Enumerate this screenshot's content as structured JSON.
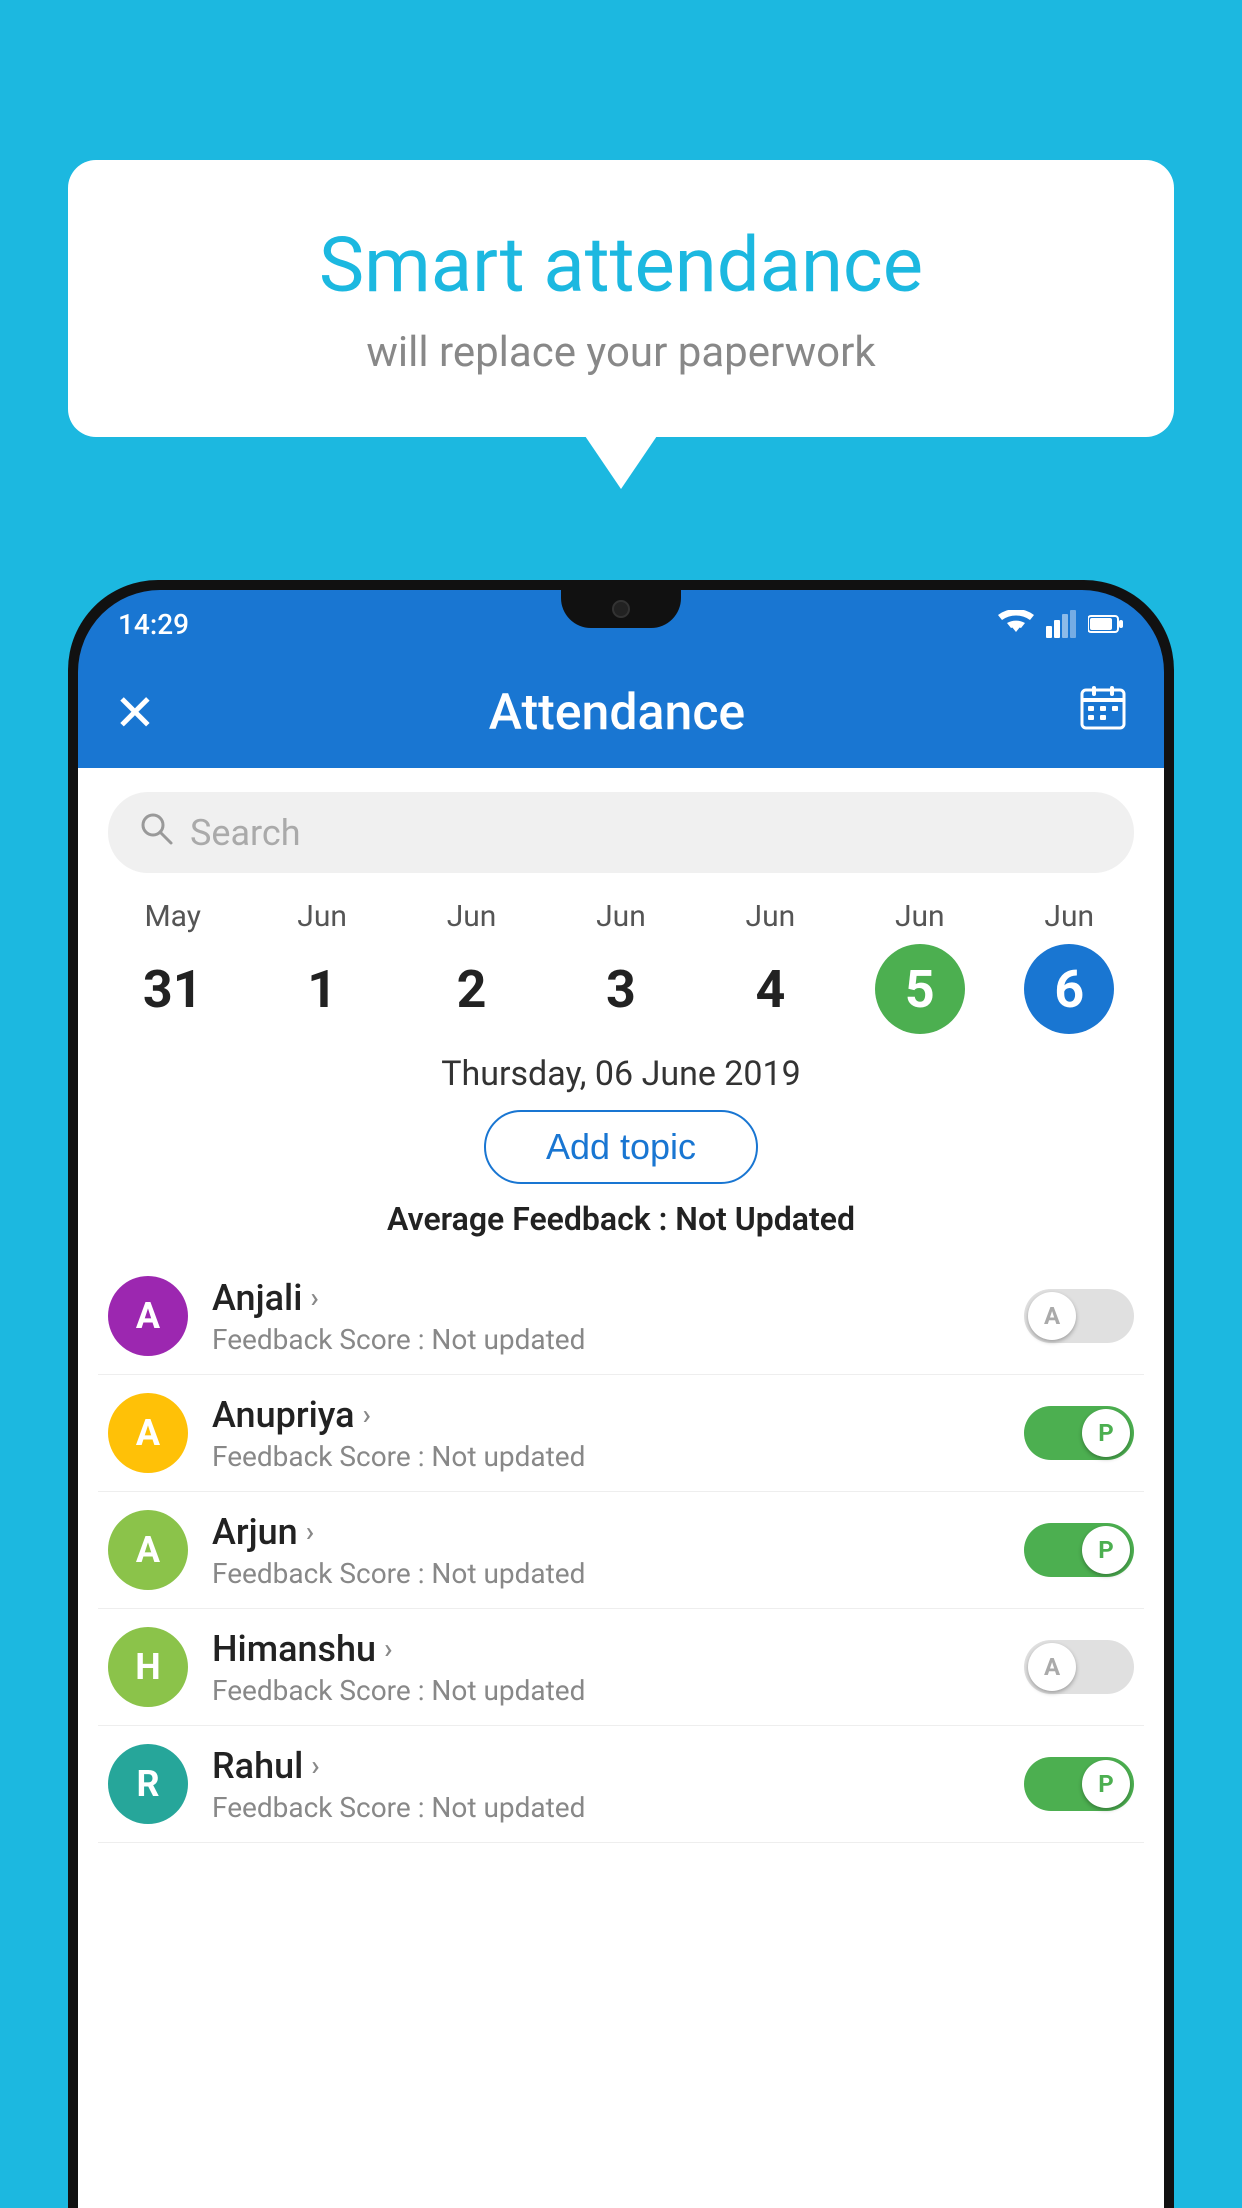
{
  "background_color": "#1CB8E0",
  "bubble": {
    "title": "Smart attendance",
    "subtitle": "will replace your paperwork"
  },
  "status_bar": {
    "time": "14:29",
    "wifi_icon": "wifi",
    "signal_icon": "signal",
    "battery_icon": "battery"
  },
  "app_bar": {
    "title": "Attendance",
    "close_icon": "×",
    "calendar_icon": "📅"
  },
  "search": {
    "placeholder": "Search"
  },
  "calendar": {
    "days": [
      {
        "month": "May",
        "date": "31",
        "style": "normal"
      },
      {
        "month": "Jun",
        "date": "1",
        "style": "normal"
      },
      {
        "month": "Jun",
        "date": "2",
        "style": "normal"
      },
      {
        "month": "Jun",
        "date": "3",
        "style": "normal"
      },
      {
        "month": "Jun",
        "date": "4",
        "style": "normal"
      },
      {
        "month": "Jun",
        "date": "5",
        "style": "green"
      },
      {
        "month": "Jun",
        "date": "6",
        "style": "blue"
      }
    ]
  },
  "selected_date": "Thursday, 06 June 2019",
  "add_topic_label": "Add topic",
  "avg_feedback_label": "Average Feedback :",
  "avg_feedback_value": "Not Updated",
  "students": [
    {
      "name": "Anjali",
      "avatar_letter": "A",
      "avatar_color": "purple-bg",
      "feedback_label": "Feedback Score :",
      "feedback_value": "Not updated",
      "toggle": "off",
      "toggle_letter": "A"
    },
    {
      "name": "Anupriya",
      "avatar_letter": "A",
      "avatar_color": "yellow-bg",
      "feedback_label": "Feedback Score :",
      "feedback_value": "Not updated",
      "toggle": "on",
      "toggle_letter": "P"
    },
    {
      "name": "Arjun",
      "avatar_letter": "A",
      "avatar_color": "green-bg",
      "feedback_label": "Feedback Score :",
      "feedback_value": "Not updated",
      "toggle": "on",
      "toggle_letter": "P"
    },
    {
      "name": "Himanshu",
      "avatar_letter": "H",
      "avatar_color": "lightgreen-bg",
      "feedback_label": "Feedback Score :",
      "feedback_value": "Not updated",
      "toggle": "off",
      "toggle_letter": "A"
    },
    {
      "name": "Rahul",
      "avatar_letter": "R",
      "avatar_color": "teal-bg",
      "feedback_label": "Feedback Score :",
      "feedback_value": "Not updated",
      "toggle": "on",
      "toggle_letter": "P"
    }
  ]
}
